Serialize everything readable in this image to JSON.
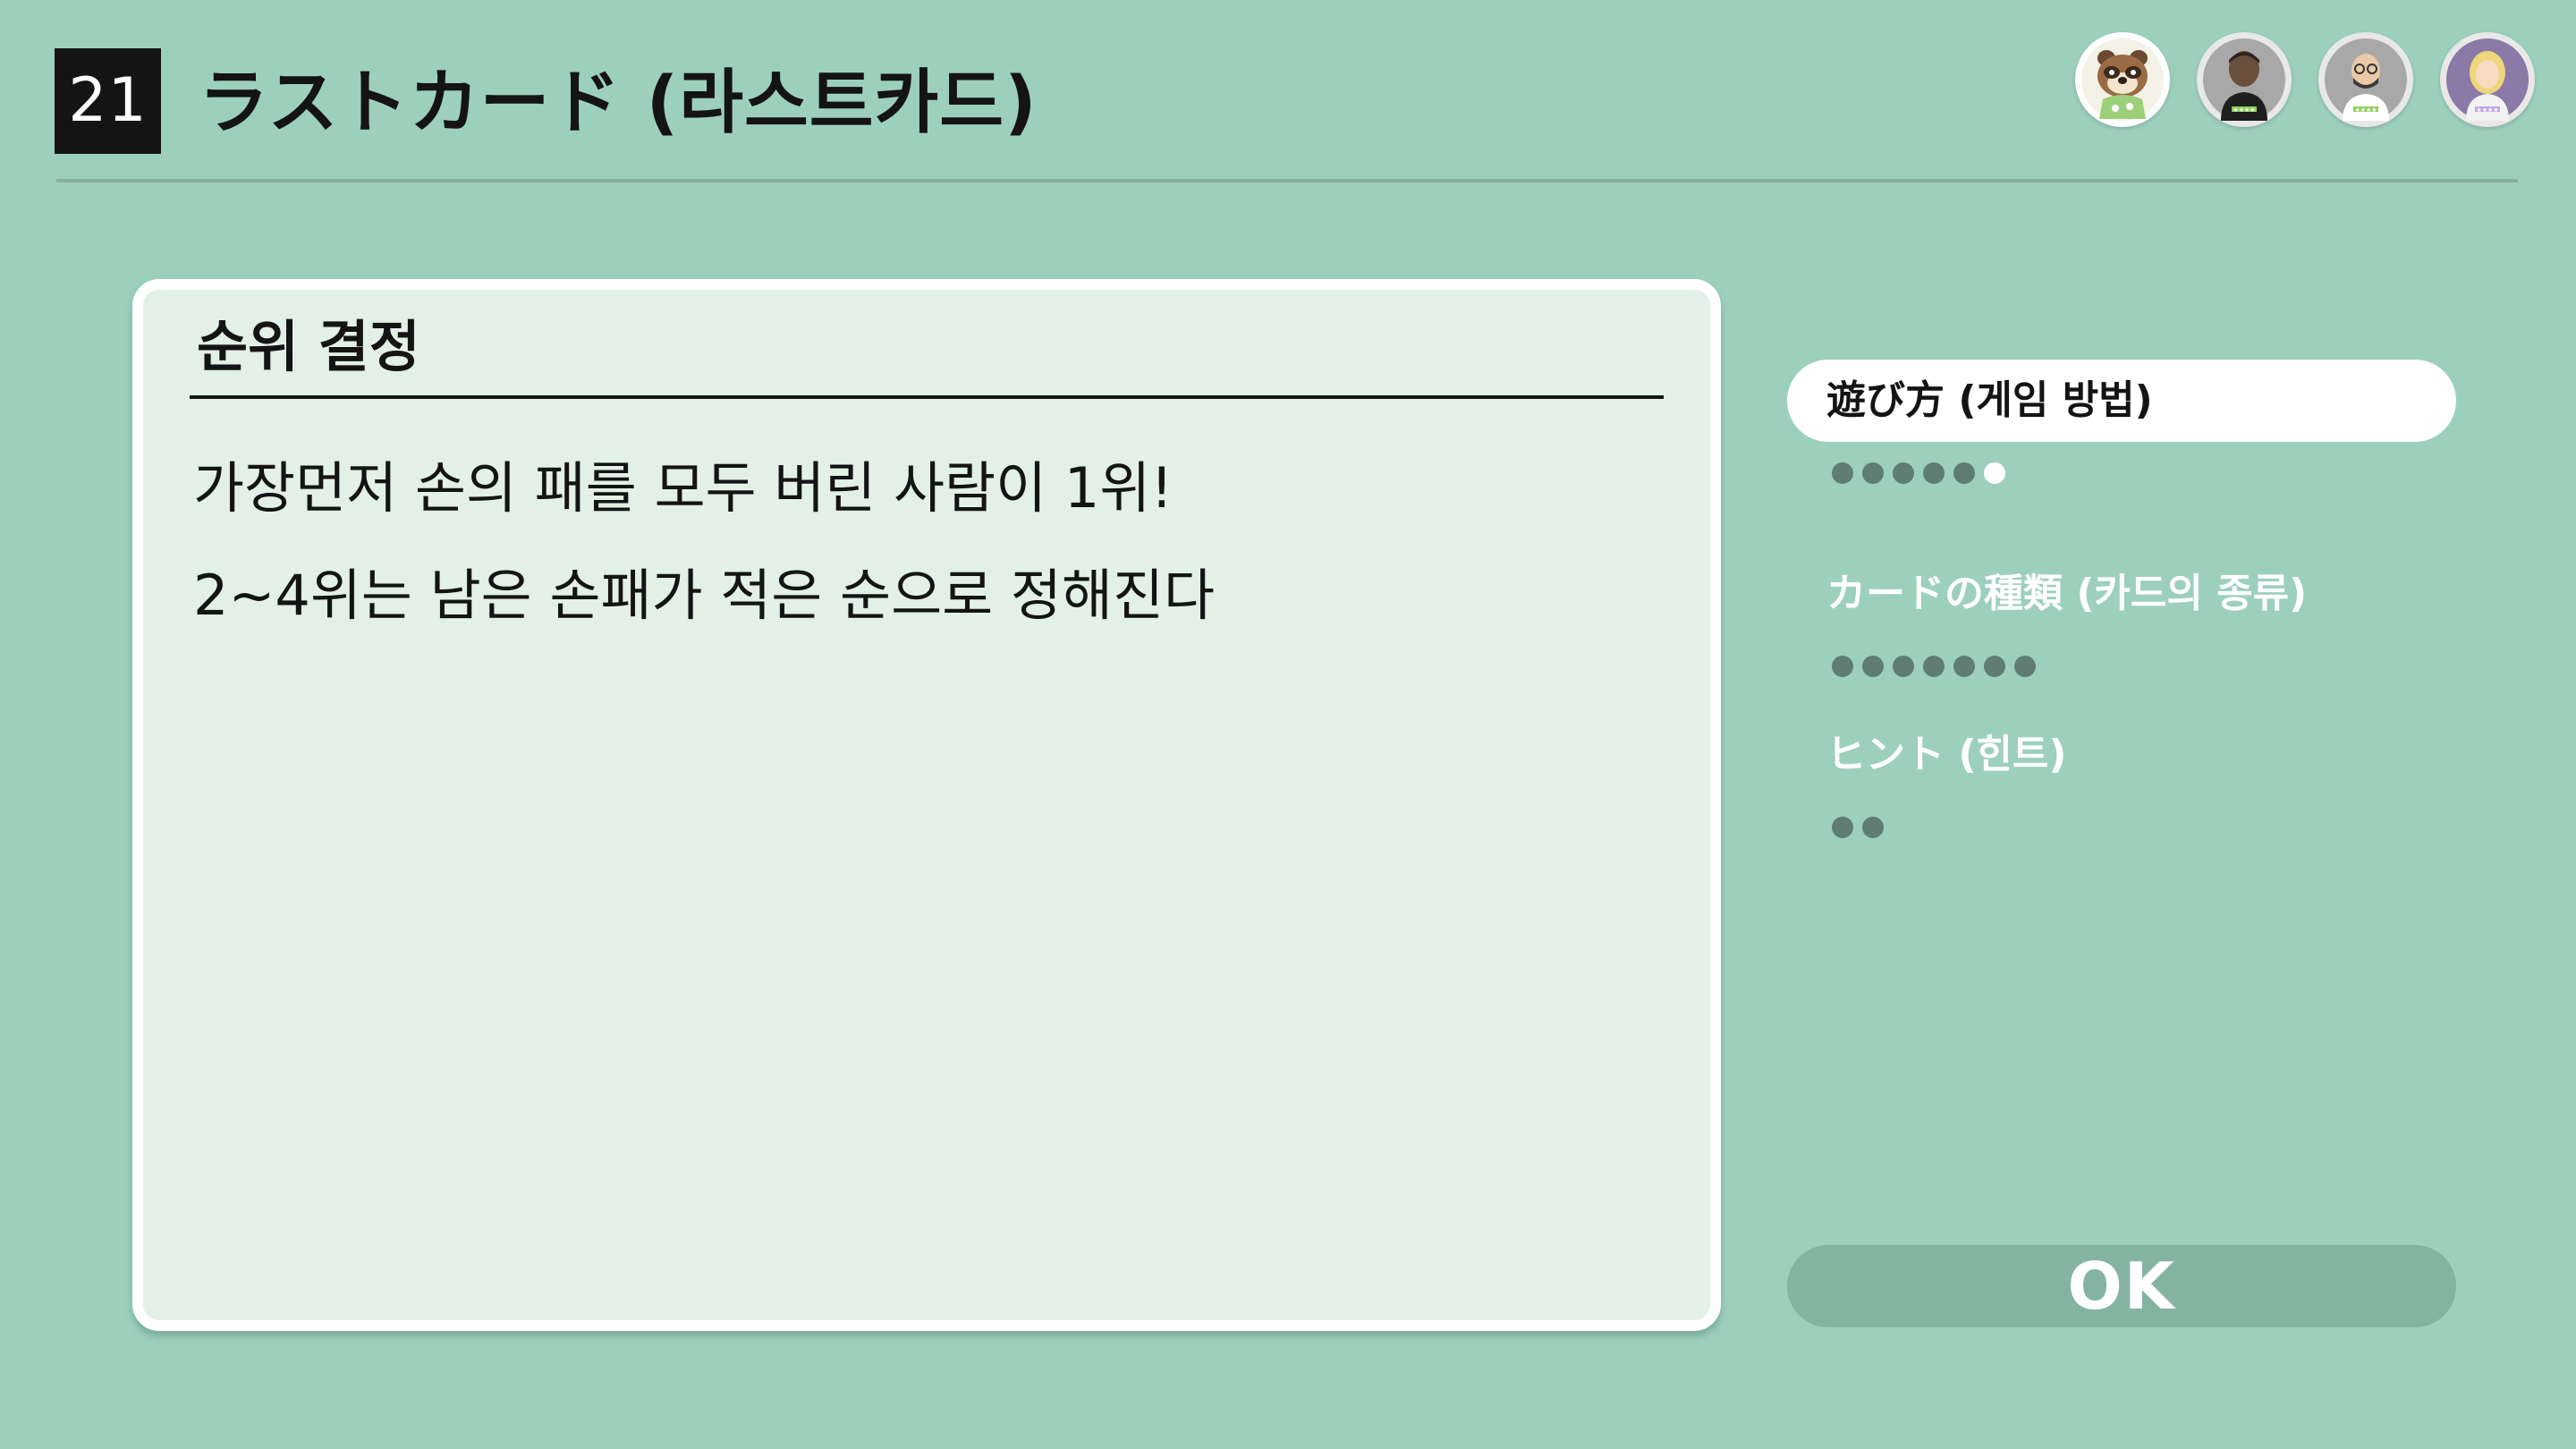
{
  "header": {
    "game_number": "21",
    "title": "ラストカード (라스트카드)"
  },
  "players": [
    {
      "name": "player-1",
      "icon": "tanuki-avatar-icon"
    },
    {
      "name": "player-2",
      "icon": "mii-avatar-icon"
    },
    {
      "name": "player-3",
      "icon": "mii-avatar-icon"
    },
    {
      "name": "player-4",
      "icon": "mii-avatar-icon"
    }
  ],
  "panel": {
    "heading": "순위 결정",
    "lines": [
      "가장먼저 손의 패를 모두 버린 사람이 1위!",
      "2~4위는 남은 손패가 적은 순으로 정해진다"
    ]
  },
  "menu": {
    "items": [
      {
        "label": "遊び方 (게임 방법)",
        "pages": 6,
        "current_page": 6,
        "selected": true
      },
      {
        "label": "カードの種類 (카드의 종류)",
        "pages": 7,
        "selected": false
      },
      {
        "label": "ヒント (힌트)",
        "pages": 2,
        "selected": false
      }
    ]
  },
  "ok_button": {
    "label": "OK"
  },
  "colors": {
    "background": "#9dcfbd",
    "panel": "#e2f0e6",
    "dot_inactive": "#5f7d73",
    "ok_button": "#84b3a2"
  }
}
